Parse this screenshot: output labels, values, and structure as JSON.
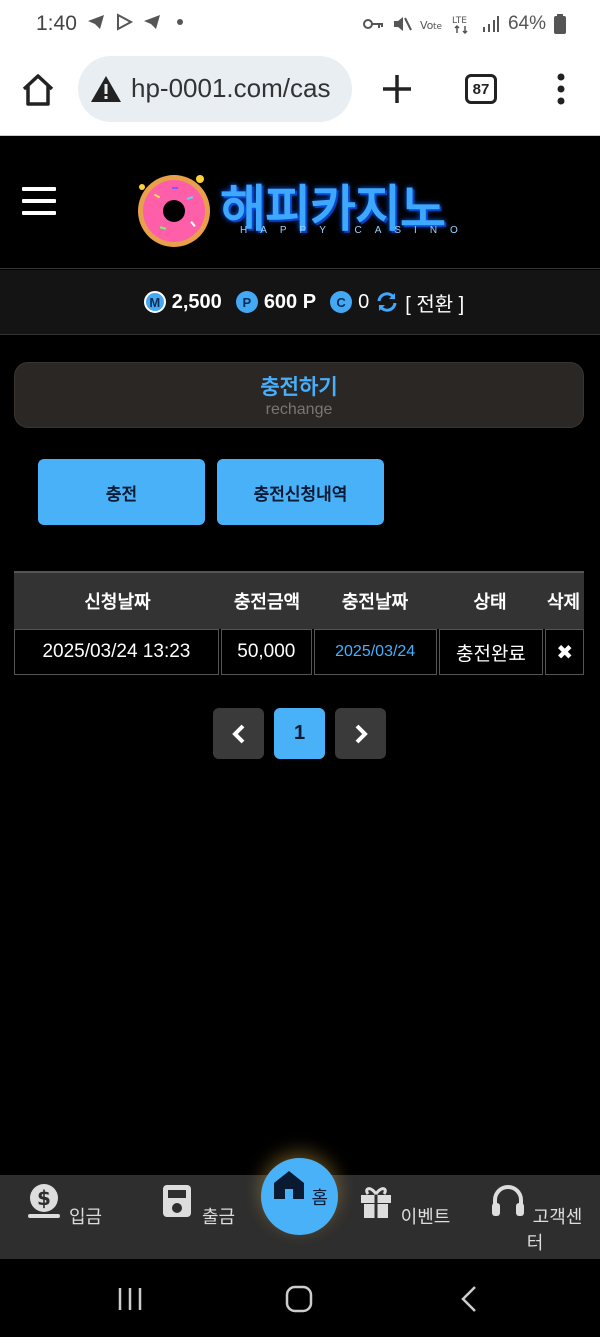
{
  "status_bar": {
    "time": "1:40",
    "left_icons": [
      "telegram-icon",
      "play-icon",
      "telegram-icon",
      "dot-icon"
    ],
    "right_icons": [
      "key-icon",
      "mute-icon",
      "vowifi-icon",
      "lte-icon",
      "signal-icon"
    ],
    "battery": "64%"
  },
  "browser": {
    "url": "hp-0001.com/cas",
    "tab_count": "87"
  },
  "site": {
    "logo_text": "해피카지노",
    "logo_sub": "HAPPY CASINO"
  },
  "balance": {
    "money_badge": "M",
    "money": "2,500",
    "point_badge": "P",
    "points": "600 P",
    "coin_badge": "C",
    "coins": "0",
    "convert_label": "[ 전환 ]"
  },
  "section": {
    "title_ko": "충전하기",
    "title_en": "rechange"
  },
  "buttons": {
    "charge": "충전",
    "history": "충전신청내역"
  },
  "table": {
    "headers": [
      "신청날짜",
      "충전금액",
      "충전날짜",
      "상태",
      "삭제"
    ],
    "rows": [
      {
        "request_date": "2025/03/24 13:23",
        "amount": "50,000",
        "charge_date": "2025/03/24",
        "status": "충전완료",
        "delete": "✖"
      }
    ]
  },
  "pagination": {
    "current": "1"
  },
  "bottom_nav": {
    "deposit": "입금",
    "withdraw": "출금",
    "home": "홈",
    "event": "이벤트",
    "support": "고객센터"
  },
  "colors": {
    "accent": "#49b1f8",
    "title_blue": "#46b0ff",
    "background": "#000000"
  }
}
